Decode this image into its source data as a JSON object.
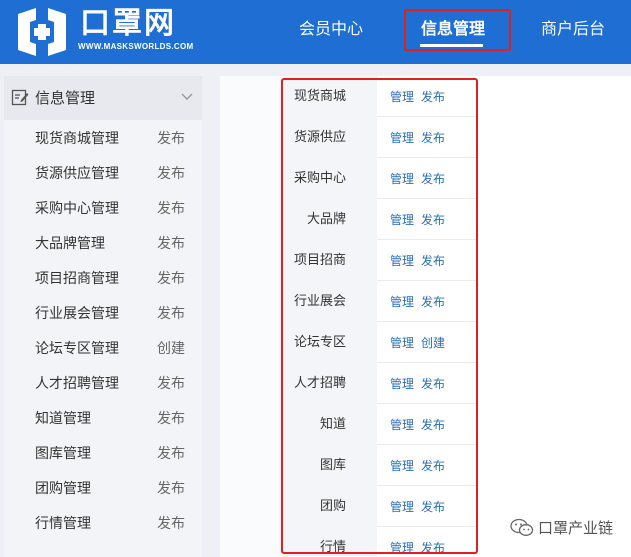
{
  "header": {
    "logo_text": "口罩网",
    "logo_url": "WWW.MASKSWORLDS.COM",
    "nav": [
      {
        "label": "会员中心"
      },
      {
        "label": "信息管理"
      },
      {
        "label": "商户后台"
      }
    ]
  },
  "sidebar": {
    "title": "信息管理",
    "items": [
      {
        "label": "现货商城管理",
        "action": "发布"
      },
      {
        "label": "货源供应管理",
        "action": "发布"
      },
      {
        "label": "采购中心管理",
        "action": "发布"
      },
      {
        "label": "大品牌管理",
        "action": "发布"
      },
      {
        "label": "项目招商管理",
        "action": "发布"
      },
      {
        "label": "行业展会管理",
        "action": "发布"
      },
      {
        "label": "论坛专区管理",
        "action": "创建"
      },
      {
        "label": "人才招聘管理",
        "action": "发布"
      },
      {
        "label": "知道管理",
        "action": "发布"
      },
      {
        "label": "图库管理",
        "action": "发布"
      },
      {
        "label": "团购管理",
        "action": "发布"
      },
      {
        "label": "行情管理",
        "action": "发布"
      }
    ]
  },
  "main": {
    "rows": [
      {
        "label": "现货商城",
        "manage": "管理",
        "action": "发布"
      },
      {
        "label": "货源供应",
        "manage": "管理",
        "action": "发布"
      },
      {
        "label": "采购中心",
        "manage": "管理",
        "action": "发布"
      },
      {
        "label": "大品牌",
        "manage": "管理",
        "action": "发布"
      },
      {
        "label": "项目招商",
        "manage": "管理",
        "action": "发布"
      },
      {
        "label": "行业展会",
        "manage": "管理",
        "action": "发布"
      },
      {
        "label": "论坛专区",
        "manage": "管理",
        "action": "创建"
      },
      {
        "label": "人才招聘",
        "manage": "管理",
        "action": "发布"
      },
      {
        "label": "知道",
        "manage": "管理",
        "action": "发布"
      },
      {
        "label": "图库",
        "manage": "管理",
        "action": "发布"
      },
      {
        "label": "团购",
        "manage": "管理",
        "action": "发布"
      },
      {
        "label": "行情",
        "manage": "管理",
        "action": "发布"
      }
    ]
  },
  "watermark": {
    "text": "口罩产业链"
  },
  "colors": {
    "header_bg": "#1f6ed4",
    "link": "#2a6fb8",
    "highlight": "#e02020"
  },
  "icons": {
    "sidebar_head": "edit-note-icon",
    "collapse": "chevron-down-icon",
    "watermark": "wechat-icon"
  }
}
